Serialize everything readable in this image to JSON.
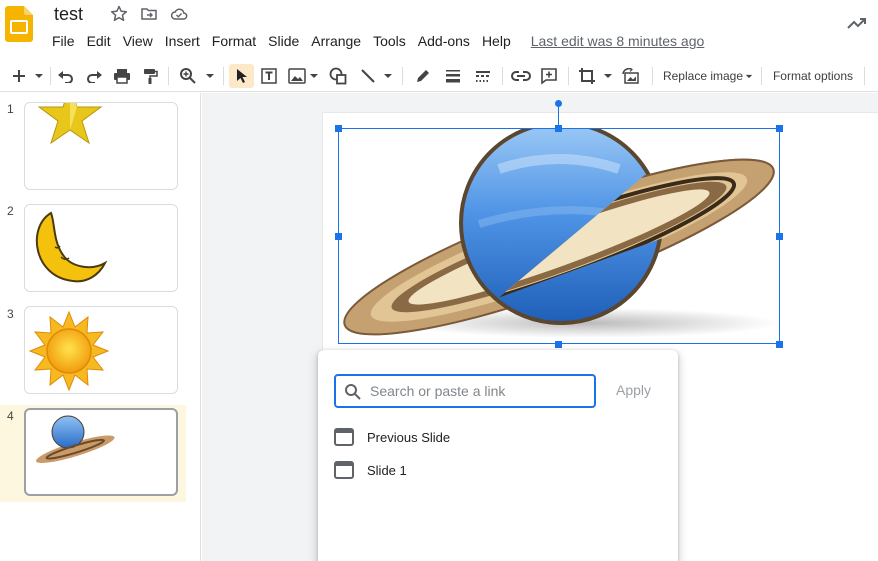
{
  "app": {
    "doc_title": "test",
    "last_edit": "Last edit was 8 minutes ago"
  },
  "menu": [
    "File",
    "Edit",
    "View",
    "Insert",
    "Format",
    "Slide",
    "Arrange",
    "Tools",
    "Add-ons",
    "Help"
  ],
  "toolbar": {
    "replace_image": "Replace image",
    "format_options": "Format options"
  },
  "slides": [
    {
      "number": "1",
      "thumb": "star"
    },
    {
      "number": "2",
      "thumb": "moon"
    },
    {
      "number": "3",
      "thumb": "sun"
    },
    {
      "number": "4",
      "thumb": "planet",
      "selected": true
    }
  ],
  "link_popup": {
    "placeholder": "Search or paste a link",
    "apply_label": "Apply",
    "items": [
      "Previous Slide",
      "Slide 1"
    ]
  },
  "colors": {
    "accent": "#1a73e8",
    "slides_yellow": "#f4b400",
    "selected_thumb_bg": "#fef7e0"
  }
}
